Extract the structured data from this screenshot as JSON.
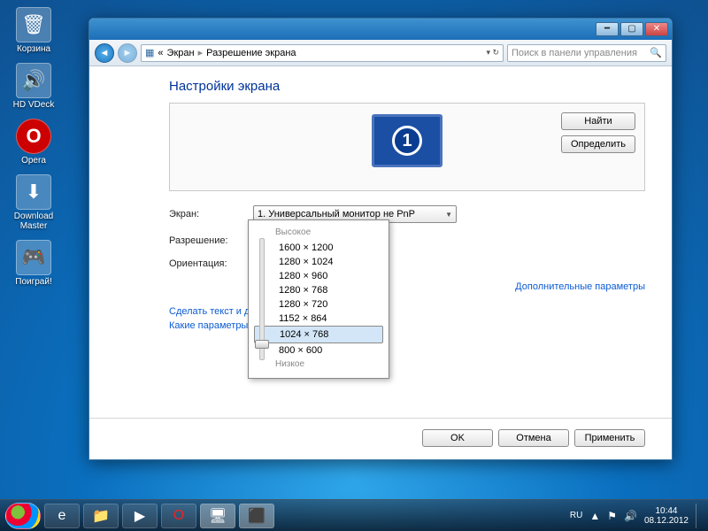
{
  "desktop": {
    "icons": [
      {
        "label": "Корзина",
        "glyph": "🗑"
      },
      {
        "label": "HD VDeck",
        "glyph": "🔊"
      },
      {
        "label": "Opera",
        "glyph": "O"
      },
      {
        "label": "Download Master",
        "glyph": "⬇"
      },
      {
        "label": "Поиграй!",
        "glyph": "🎮"
      }
    ]
  },
  "window": {
    "breadcrumb": {
      "root": "«",
      "item1": "Экран",
      "item2": "Разрешение экрана"
    },
    "search_placeholder": "Поиск в панели управления",
    "title": "Настройки экрана",
    "buttons": {
      "find": "Найти",
      "detect": "Определить"
    },
    "fields": {
      "display_label": "Экран:",
      "display_value": "1. Универсальный монитор не PnP",
      "resolution_label": "Разрешение:",
      "resolution_value": "1024 × 768",
      "orientation_label": "Ориентация:"
    },
    "adv_link": "Дополнительные параметры",
    "link1": "Сделать текст и другие",
    "link2": "Какие параметры мон",
    "ok": "OK",
    "cancel": "Отмена",
    "apply": "Применить",
    "monitor_number": "1"
  },
  "dropdown": {
    "high": "Высокое",
    "low": "Низкое",
    "options": [
      "1600 × 1200",
      "1280 × 1024",
      "1280 × 960",
      "1280 × 768",
      "1280 × 720",
      "1152 × 864",
      "1024 × 768",
      "800 × 600"
    ],
    "selected_index": 6
  },
  "taskbar": {
    "start": "Пуск",
    "lang": "RU",
    "time": "10:44",
    "date": "08.12.2012"
  }
}
